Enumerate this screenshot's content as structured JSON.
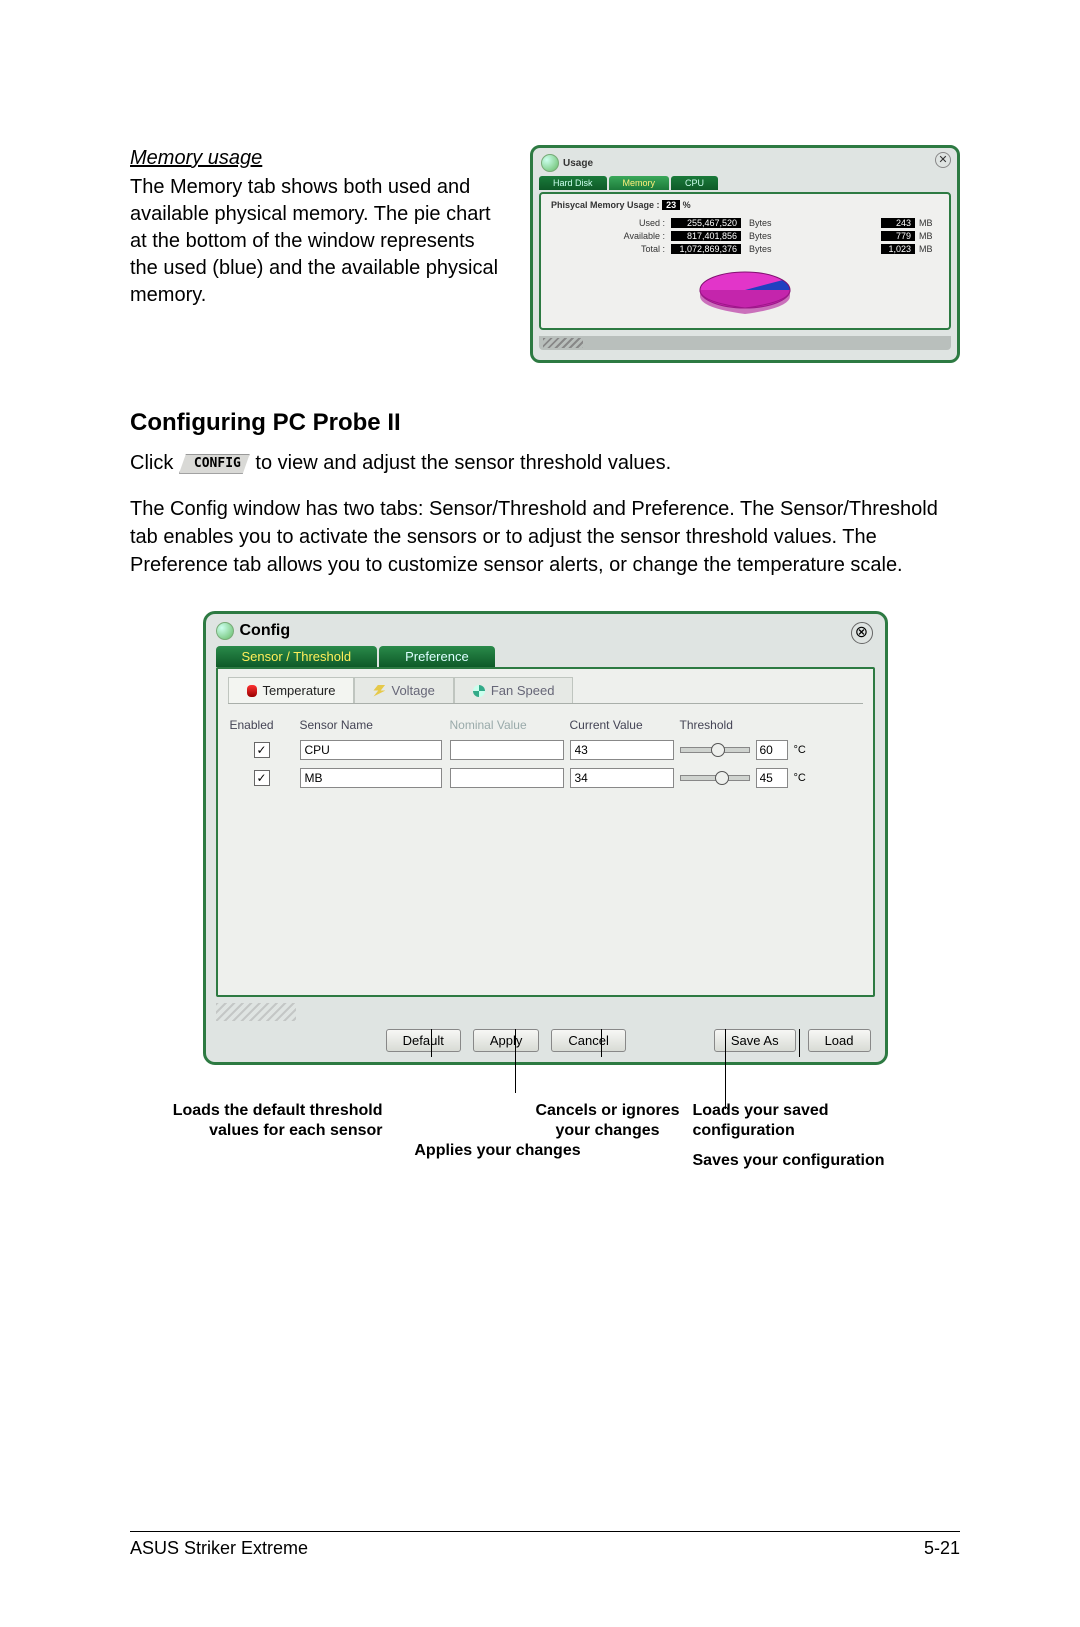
{
  "memory": {
    "heading": "Memory usage",
    "body": "The Memory tab shows both used and available physical memory. The pie chart at the bottom of the window represents the used (blue) and the available physical memory."
  },
  "usage_window": {
    "title": "Usage",
    "tabs": [
      "Hard Disk",
      "Memory",
      "CPU"
    ],
    "active_tab_index": 1,
    "label": "Phisycal Memory Usage :",
    "percent": "23",
    "percent_unit": "%",
    "rows": [
      {
        "label": "Used :",
        "bytes": "255,467,520",
        "unit1": "Bytes",
        "mb": "243",
        "unit2": "MB"
      },
      {
        "label": "Available :",
        "bytes": "817,401,856",
        "unit1": "Bytes",
        "mb": "779",
        "unit2": "MB"
      },
      {
        "label": "Total :",
        "bytes": "1,072,869,376",
        "unit1": "Bytes",
        "mb": "1,023",
        "unit2": "MB"
      }
    ]
  },
  "configuring": {
    "heading": "Configuring PC Probe II",
    "click_prefix": "Click ",
    "config_badge": "CONFIG",
    "click_suffix": " to view and adjust the sensor threshold values.",
    "paragraph": "The Config window has two tabs: Sensor/Threshold and Preference. The Sensor/Threshold tab enables you to activate the sensors or to adjust the sensor threshold values. The Preference tab allows you to customize sensor alerts, or change the temperature scale."
  },
  "config_window": {
    "title": "Config",
    "tabs": [
      "Sensor / Threshold",
      "Preference"
    ],
    "active_tab_index": 0,
    "subtabs": [
      "Temperature",
      "Voltage",
      "Fan Speed"
    ],
    "active_subtab_index": 0,
    "headers": {
      "enabled": "Enabled",
      "sensor": "Sensor Name",
      "nominal": "Nominal Value",
      "current": "Current Value",
      "threshold": "Threshold"
    },
    "rows": [
      {
        "enabled": true,
        "sensor": "CPU",
        "nominal": "",
        "current": "43",
        "threshold": "60",
        "unit": "°C",
        "thumb_pct": 45
      },
      {
        "enabled": true,
        "sensor": "MB",
        "nominal": "",
        "current": "34",
        "threshold": "45",
        "unit": "°C",
        "thumb_pct": 50
      }
    ],
    "buttons": {
      "default": "Default",
      "apply": "Apply",
      "cancel": "Cancel",
      "save_as": "Save As",
      "load": "Load"
    }
  },
  "callouts": {
    "default": "Loads the default threshold values for each sensor",
    "apply": "Applies your changes",
    "cancel": "Cancels or ignores your changes",
    "save_as": "Saves your configuration",
    "load": "Loads your saved configuration"
  },
  "footer": {
    "left": "ASUS Striker Extreme",
    "right": "5-21"
  },
  "chart_data": {
    "type": "pie",
    "title": "Physical Memory Usage",
    "series": [
      {
        "name": "Used (blue)",
        "value": 23
      },
      {
        "name": "Available (magenta)",
        "value": 77
      }
    ]
  }
}
